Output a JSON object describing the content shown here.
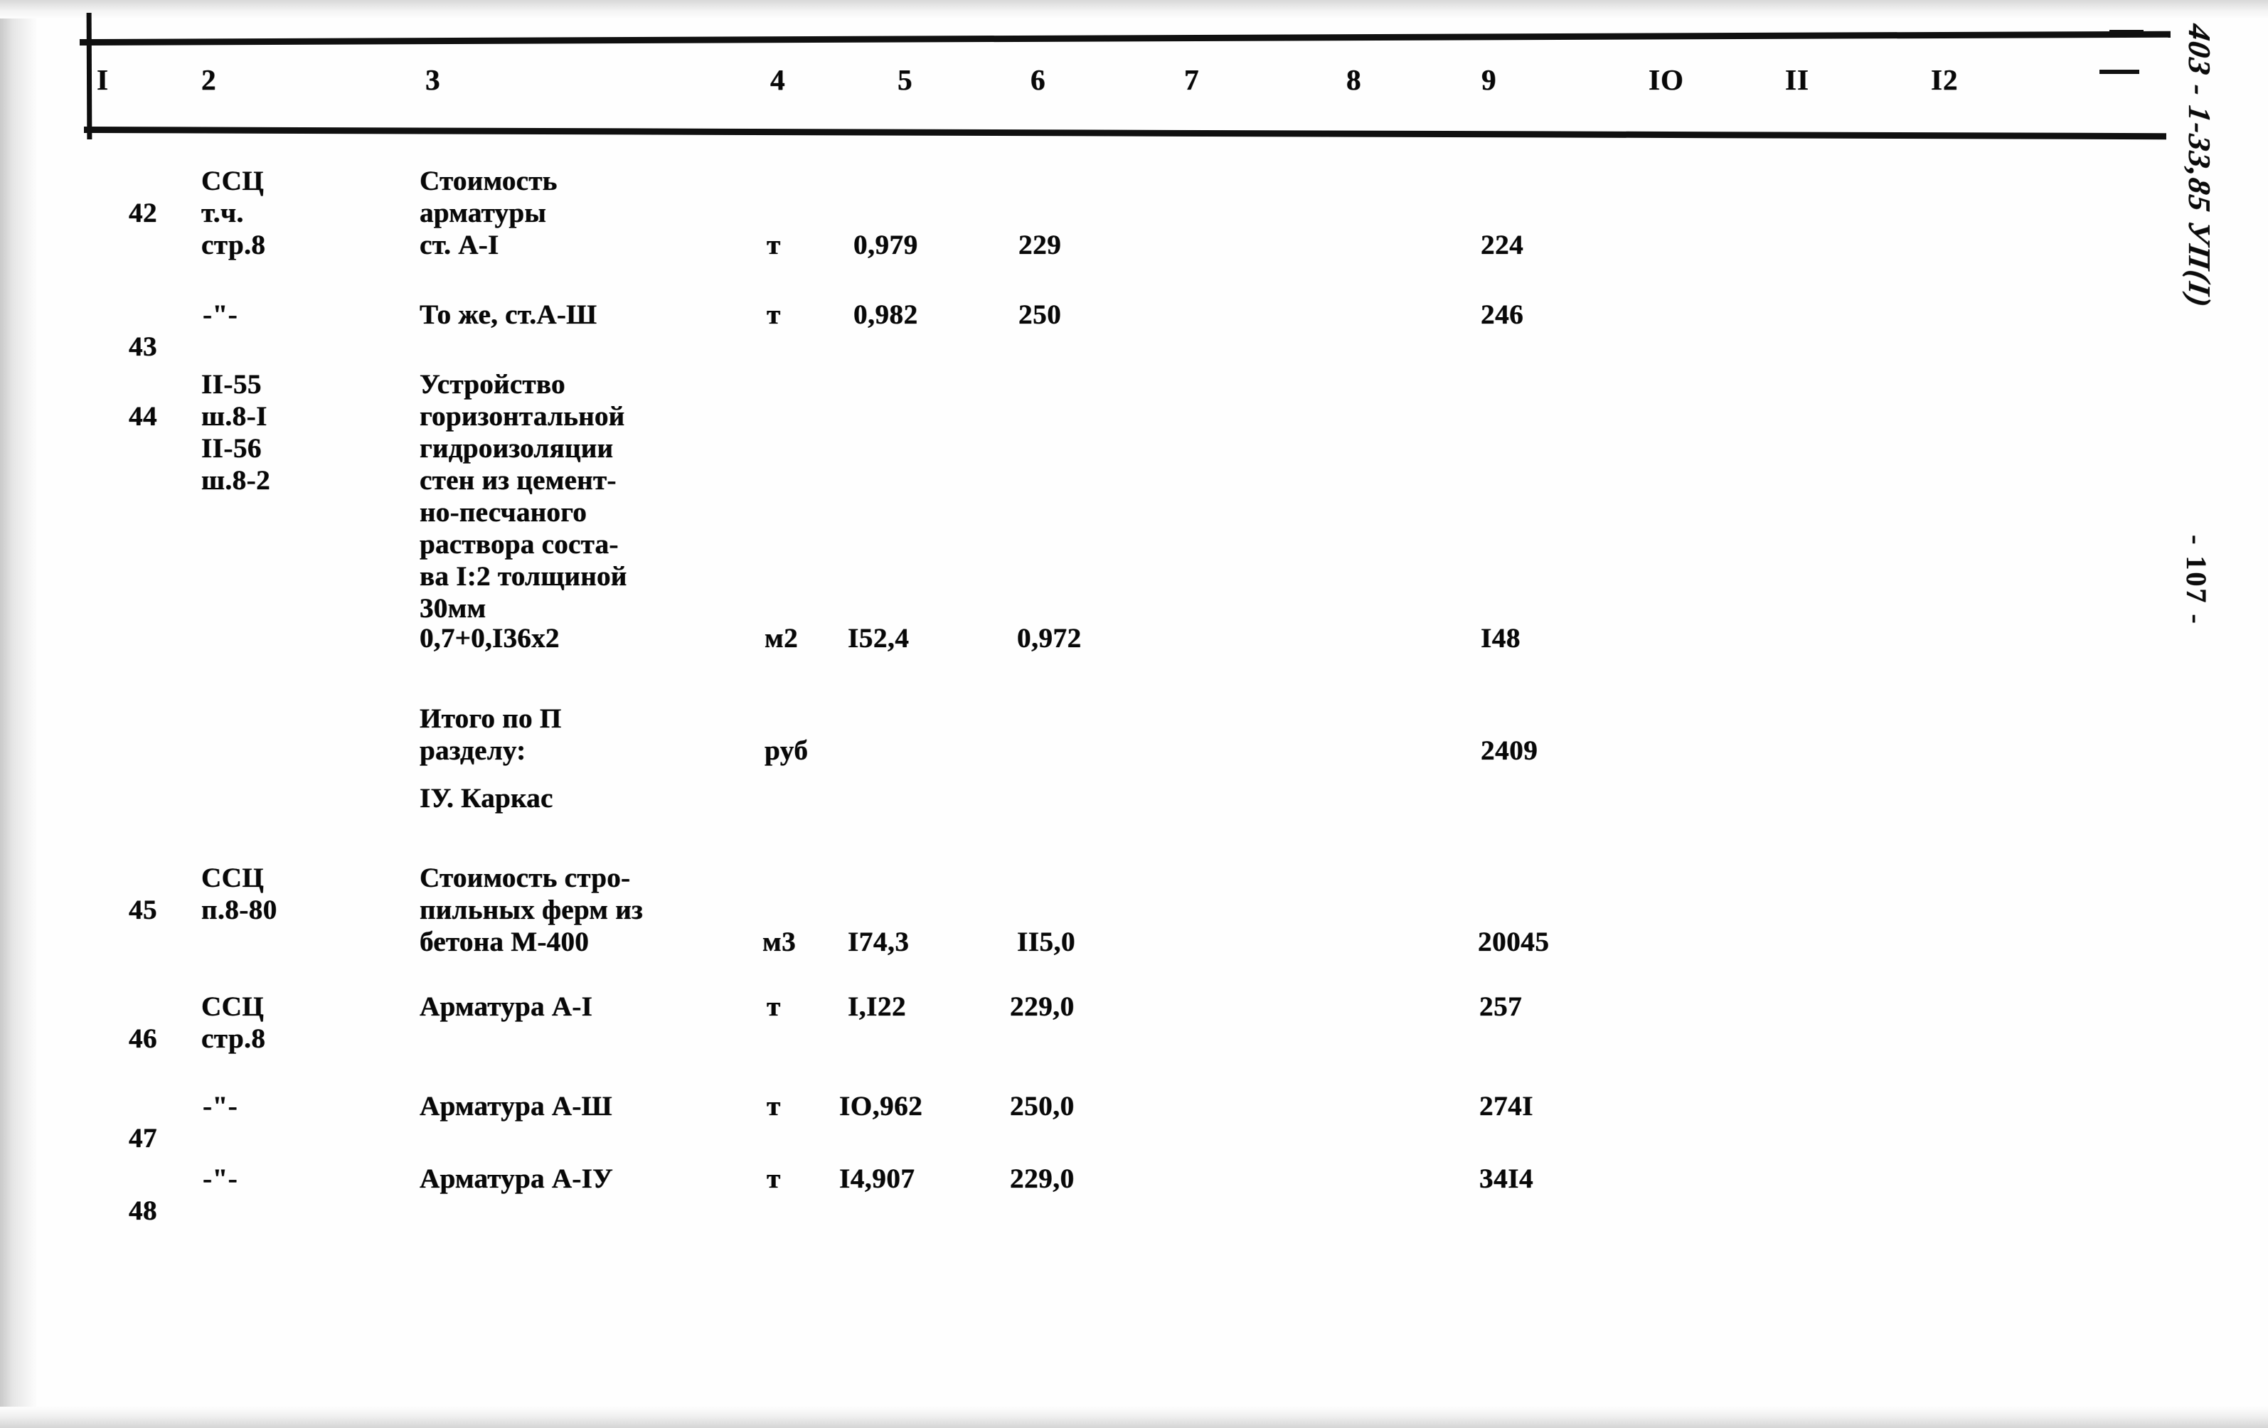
{
  "document": {
    "margin_code": "403 - 1-33,85 УП(I)",
    "page_marker": "- 107 -"
  },
  "table": {
    "column_headers": [
      "I",
      "2",
      "3",
      "4",
      "5",
      "6",
      "7",
      "8",
      "9",
      "IO",
      "II",
      "I2"
    ],
    "rows": [
      {
        "num": "42",
        "code": "ССЦ\nт.ч.\nстр.8",
        "description": "Стоимость\nарматуры\nст. А-I",
        "unit": "т",
        "col5": "0,979",
        "col6": "229",
        "col7": "",
        "col8": "",
        "col9": "224",
        "col10": "",
        "col11": "",
        "col12": ""
      },
      {
        "num": "43",
        "code": "-\"-",
        "description": "То же, ст.А-Ш",
        "unit": "т",
        "col5": "0,982",
        "col6": "250",
        "col7": "",
        "col8": "",
        "col9": "246",
        "col10": "",
        "col11": "",
        "col12": ""
      },
      {
        "num": "44",
        "code": "II-55\nш.8-I\nII-56\nш.8-2",
        "description": "Устройство\nгоризонтальной\nгидроизоляции\nстен из цемент-\nно-песчаного\nраствора соста-\nва I:2 толщиной\n30мм",
        "description2": "0,7+0,I36х2",
        "unit": "м2",
        "col5": "I52,4",
        "col6": "0,972",
        "col7": "",
        "col8": "",
        "col9": "I48",
        "col10": "",
        "col11": "",
        "col12": ""
      },
      {
        "num": "",
        "code": "",
        "description": "Итого по П\nразделу:",
        "unit": "руб",
        "col5": "",
        "col6": "",
        "col7": "",
        "col8": "",
        "col9": "2409",
        "col10": "",
        "col11": "",
        "col12": ""
      },
      {
        "num": "",
        "code": "",
        "description": "IУ. Каркас",
        "unit": "",
        "col5": "",
        "col6": "",
        "col7": "",
        "col8": "",
        "col9": "",
        "col10": "",
        "col11": "",
        "col12": ""
      },
      {
        "num": "45",
        "code": "ССЦ\nп.8-80",
        "description": "Стоимость стро-\nпильных ферм из\nбетона М-400",
        "unit": "м3",
        "col5": "I74,3",
        "col6": "II5,0",
        "col7": "",
        "col8": "",
        "col9": "20045",
        "col10": "",
        "col11": "",
        "col12": ""
      },
      {
        "num": "46",
        "code": "ССЦ\nстр.8",
        "description": "Арматура А-I",
        "unit": "т",
        "col5": "I,I22",
        "col6": "229,0",
        "col7": "",
        "col8": "",
        "col9": "257",
        "col10": "",
        "col11": "",
        "col12": ""
      },
      {
        "num": "47",
        "code": "-\"-",
        "description": "Арматура А-Ш",
        "unit": "т",
        "col5": "IO,962",
        "col6": "250,0",
        "col7": "",
        "col8": "",
        "col9": "274I",
        "col10": "",
        "col11": "",
        "col12": ""
      },
      {
        "num": "48",
        "code": "-\"-",
        "description": "Арматура А-IУ",
        "unit": "т",
        "col5": "I4,907",
        "col6": "229,0",
        "col7": "",
        "col8": "",
        "col9": "34I4",
        "col10": "",
        "col11": "",
        "col12": ""
      }
    ]
  }
}
